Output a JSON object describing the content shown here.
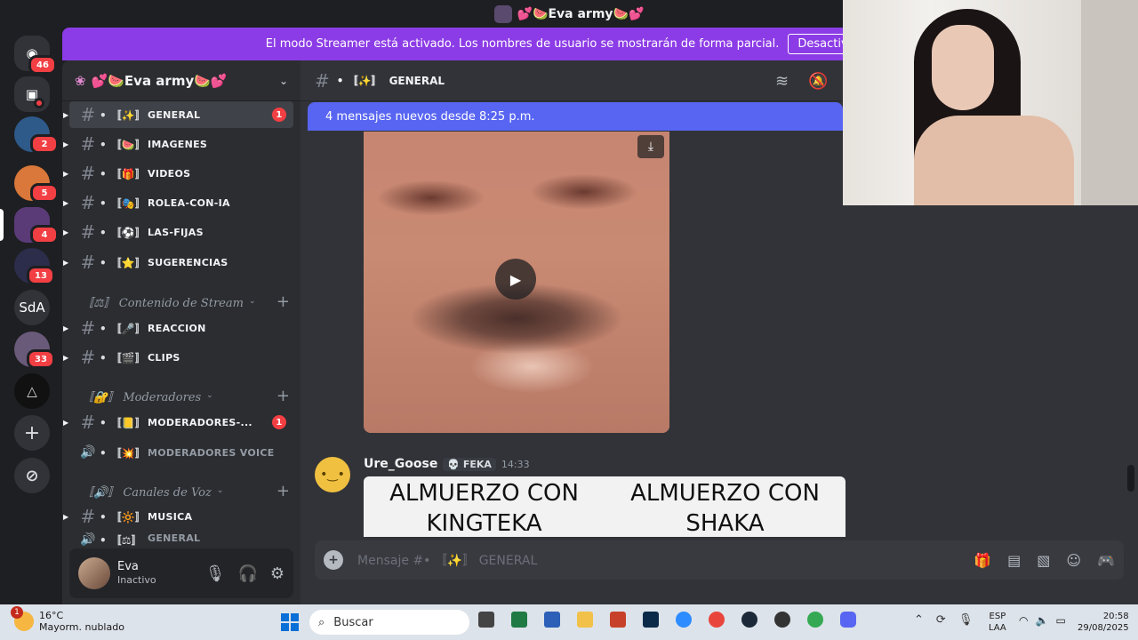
{
  "window": {
    "title": "💕🍉Eva army🍉💕"
  },
  "banner": {
    "text": "El modo Streamer está activado. Los nombres de usuario se mostrarán de forma parcial.",
    "button": "Desactivar"
  },
  "guilds": [
    {
      "name": "direct-messages",
      "badge": "46"
    },
    {
      "name": "inbox",
      "badge": ""
    },
    {
      "name": "server-1",
      "badge": "2"
    },
    {
      "name": "server-2",
      "badge": "5"
    },
    {
      "name": "server-3",
      "badge": "4"
    },
    {
      "name": "server-4",
      "badge": "13"
    },
    {
      "name": "SdA",
      "badge": ""
    },
    {
      "name": "server-6",
      "badge": "33"
    },
    {
      "name": "server-7",
      "badge": ""
    }
  ],
  "server": {
    "name": "💕🍉Eva army🍉💕"
  },
  "channels": [
    {
      "deco": "• 〚✨〛",
      "name": "GENERAL",
      "unread": "1"
    },
    {
      "deco": "• 〚🍉〛",
      "name": "IMAGENES",
      "unread": ""
    },
    {
      "deco": "• 〚🎁〛",
      "name": "VIDEOS",
      "unread": ""
    },
    {
      "deco": "• 〚🎭〛",
      "name": "ROLEA-CON-IA",
      "unread": ""
    },
    {
      "deco": "• 〚⚽〛",
      "name": "LAS-FIJAS",
      "unread": ""
    },
    {
      "deco": "• 〚⭐〛",
      "name": "SUGERENCIAS",
      "unread": ""
    },
    {
      "deco": "• 〚🎤〛",
      "name": "REACCION",
      "unread": ""
    },
    {
      "deco": "• 〚🎬〛",
      "name": "CLIPS",
      "unread": ""
    },
    {
      "deco": "• 〚📒〛",
      "name": "MODERADORES-...",
      "unread": "1"
    },
    {
      "deco": "• 〚💥〛",
      "name": "MODERADORES VOICE",
      "unread": ""
    },
    {
      "deco": "• 〚🔆〛",
      "name": "MUSICA",
      "unread": ""
    },
    {
      "deco": "• 〚⚖〛",
      "name": "GENERAL",
      "unread": ""
    }
  ],
  "categories": [
    {
      "label": "〚⚖〛 Contenido de Stream"
    },
    {
      "label": "〚🔐〛 Moderadores"
    },
    {
      "label": "〚🔊〛 Canales de Voz"
    }
  ],
  "user": {
    "name": "Eva",
    "status": "Inactivo"
  },
  "channel_header": {
    "deco": "• 〚✨〛",
    "name": "GENERAL"
  },
  "new_messages": "4 mensajes nuevos desde 8:25 p.m.",
  "message": {
    "author": "Ure_Goose",
    "tag": "💀 FEKA",
    "time": "14:33",
    "meme_left": "ALMUERZO  CON\nKINGTEKA",
    "meme_right": "ALMUERZO  CON\nSHAKA"
  },
  "composer": {
    "placeholder": "Mensaje #• 〚✨〛 GENERAL"
  },
  "taskbar": {
    "weather_temp": "16°C",
    "weather_desc": "Mayorm. nublado",
    "weather_badge": "1",
    "search": "Buscar",
    "lang1": "ESP",
    "lang2": "LAA",
    "time": "20:58",
    "date": "29/08/2025"
  }
}
